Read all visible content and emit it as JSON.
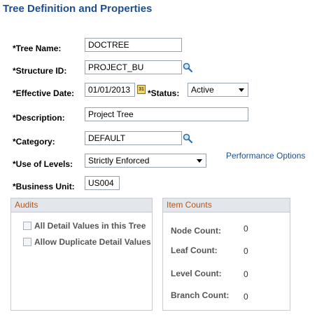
{
  "page_title": "Tree Definition and Properties",
  "fields": {
    "tree_name": {
      "label": "*Tree Name:",
      "value": "DOCTREE"
    },
    "structure_id": {
      "label": "*Structure ID:",
      "value": "PROJECT_BU"
    },
    "effective_date": {
      "label": "*Effective Date:",
      "value": "01/01/2013",
      "calendar_glyph": "31"
    },
    "status": {
      "label": "*Status:",
      "value": "Active"
    },
    "description": {
      "label": "*Description:",
      "value": "Project Tree"
    },
    "category": {
      "label": "*Category:",
      "value": "DEFAULT"
    },
    "use_of_levels": {
      "label": "*Use of Levels:",
      "value": "Strictly Enforced"
    },
    "business_unit": {
      "label": "*Business Unit:",
      "value": "US004"
    }
  },
  "performance_options_link": "Performance Options",
  "audits": {
    "title": "Audits",
    "items": [
      {
        "label": "All Detail Values in this Tree",
        "checked": false
      },
      {
        "label": "Allow Duplicate Detail Values",
        "checked": false
      }
    ]
  },
  "item_counts": {
    "title": "Item Counts",
    "rows": [
      {
        "label": "Node Count:",
        "value": "0"
      },
      {
        "label": "Leaf Count:",
        "value": "0"
      },
      {
        "label": "Level Count:",
        "value": "0"
      },
      {
        "label": "Branch Count:",
        "value": "0"
      }
    ]
  },
  "icons": {
    "lookup": "magnifier-icon",
    "calendar": "calendar-icon",
    "dropdown": "chevron-down-icon"
  },
  "colors": {
    "title": "#1f4e8c",
    "link": "#1f4e8c",
    "group_header_text": "#b0571b",
    "group_header_bg": "#e3e7ec"
  }
}
